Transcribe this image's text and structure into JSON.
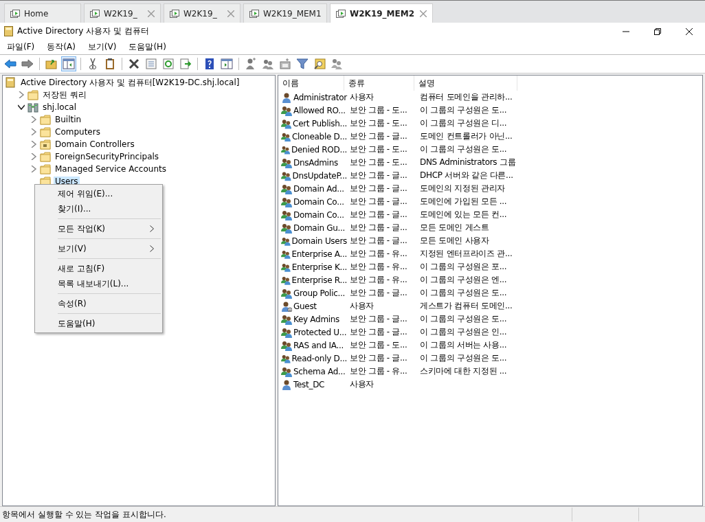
{
  "browser_tabs": [
    {
      "label": "Home",
      "selected": false,
      "closable": false
    },
    {
      "label": "W2K19_",
      "selected": false,
      "closable": true
    },
    {
      "label": "W2K19_",
      "selected": false,
      "closable": true
    },
    {
      "label": "W2K19_MEM1",
      "selected": false,
      "closable": false
    },
    {
      "label": "W2K19_MEM2",
      "selected": true,
      "closable": true
    }
  ],
  "window": {
    "title": "Active Directory 사용자 및 컴퓨터"
  },
  "menu": [
    "파일(F)",
    "동작(A)",
    "보기(V)",
    "도움말(H)"
  ],
  "tree": [
    {
      "label": "Active Directory 사용자 및 컴퓨터[W2K19-DC.shj.local]",
      "kind": "root",
      "selected": false,
      "children": [
        {
          "label": "저장된 쿼리",
          "kind": "folder",
          "expanded": false,
          "selected": false
        },
        {
          "label": "shj.local",
          "kind": "domain",
          "expanded": true,
          "selected": false,
          "children": [
            {
              "label": "Builtin",
              "kind": "folder",
              "expanded": false,
              "selected": false
            },
            {
              "label": "Computers",
              "kind": "folder",
              "expanded": false,
              "selected": false
            },
            {
              "label": "Domain Controllers",
              "kind": "ou",
              "expanded": false,
              "selected": false
            },
            {
              "label": "ForeignSecurityPrincipals",
              "kind": "folder",
              "expanded": false,
              "selected": false
            },
            {
              "label": "Managed Service Accounts",
              "kind": "folder",
              "expanded": false,
              "selected": false
            },
            {
              "label": "Users",
              "kind": "leaf",
              "selected": true
            }
          ]
        }
      ]
    }
  ],
  "context_menu": [
    {
      "kind": "item",
      "label": "제어 위임(E)...",
      "submenu": false
    },
    {
      "kind": "item",
      "label": "찾기(I)...",
      "submenu": false
    },
    {
      "kind": "separator"
    },
    {
      "kind": "item",
      "label": "모든 작업(K)",
      "submenu": true
    },
    {
      "kind": "separator"
    },
    {
      "kind": "item",
      "label": "보기(V)",
      "submenu": true
    },
    {
      "kind": "separator"
    },
    {
      "kind": "item",
      "label": "새로 고침(F)",
      "submenu": false
    },
    {
      "kind": "item",
      "label": "목록 내보내기(L)...",
      "submenu": false
    },
    {
      "kind": "separator"
    },
    {
      "kind": "item",
      "label": "속성(R)",
      "submenu": false
    },
    {
      "kind": "separator"
    },
    {
      "kind": "item",
      "label": "도움말(H)",
      "submenu": false
    }
  ],
  "list": {
    "columns": [
      "이름",
      "종류",
      "설명"
    ],
    "rows": [
      {
        "kind": "user",
        "name": "Administrator",
        "type": "사용자",
        "description": "컴퓨터 도메인을 관리하..."
      },
      {
        "kind": "group",
        "name": "Allowed RO...",
        "type": "보안 그룹 - 도...",
        "description": "이 그룹의 구성원은 도..."
      },
      {
        "kind": "group",
        "name": "Cert Publish...",
        "type": "보안 그룹 - 도...",
        "description": "이 그룹의 구성원은 디..."
      },
      {
        "kind": "group",
        "name": "Cloneable D...",
        "type": "보안 그룹 - 글...",
        "description": "도메인 컨트롤러가 아닌..."
      },
      {
        "kind": "group",
        "name": "Denied ROD...",
        "type": "보안 그룹 - 도...",
        "description": "이 그룹의 구성원은 도..."
      },
      {
        "kind": "group",
        "name": "DnsAdmins",
        "type": "보안 그룹 - 도...",
        "description": "DNS Administrators 그룹"
      },
      {
        "kind": "group",
        "name": "DnsUpdateP...",
        "type": "보안 그룹 - 글...",
        "description": "DHCP 서버와 같은 다른..."
      },
      {
        "kind": "group",
        "name": "Domain Ad...",
        "type": "보안 그룹 - 글...",
        "description": "도메인의 지정된 관리자"
      },
      {
        "kind": "group",
        "name": "Domain Co...",
        "type": "보안 그룹 - 글...",
        "description": "도메인에 가입된 모든 ..."
      },
      {
        "kind": "group",
        "name": "Domain Co...",
        "type": "보안 그룹 - 글...",
        "description": "도메인에 있는 모든 컨..."
      },
      {
        "kind": "group",
        "name": "Domain Gu...",
        "type": "보안 그룹 - 글...",
        "description": "모든 도메인 게스트"
      },
      {
        "kind": "group",
        "name": "Domain Users",
        "type": "보안 그룹 - 글...",
        "description": "모든 도메인 사용자"
      },
      {
        "kind": "group",
        "name": "Enterprise A...",
        "type": "보안 그룹 - 유...",
        "description": "지정된 엔터프라이즈 관..."
      },
      {
        "kind": "group",
        "name": "Enterprise K...",
        "type": "보안 그룹 - 유...",
        "description": "이 그룹의 구성원은 포..."
      },
      {
        "kind": "group",
        "name": "Enterprise R...",
        "type": "보안 그룹 - 유...",
        "description": "이 그룹의 구성원은 엔..."
      },
      {
        "kind": "group",
        "name": "Group Polic...",
        "type": "보안 그룹 - 글...",
        "description": "이 그룹의 구성원은 도..."
      },
      {
        "kind": "disabled-user",
        "name": "Guest",
        "type": "사용자",
        "description": "게스트가 컴퓨터 도메인..."
      },
      {
        "kind": "group",
        "name": "Key Admins",
        "type": "보안 그룹 - 글...",
        "description": "이 그룹의 구성원은 도..."
      },
      {
        "kind": "group",
        "name": "Protected U...",
        "type": "보안 그룹 - 글...",
        "description": "이 그룹의 구성원은 인..."
      },
      {
        "kind": "group",
        "name": "RAS and IA...",
        "type": "보안 그룹 - 도...",
        "description": "이 그룹의 서버는 사용..."
      },
      {
        "kind": "group",
        "name": "Read-only D...",
        "type": "보안 그룹 - 글...",
        "description": "이 그룹의 구성원은 도..."
      },
      {
        "kind": "group",
        "name": "Schema Ad...",
        "type": "보안 그룹 - 유...",
        "description": "스키마에 대한 지정된 ..."
      },
      {
        "kind": "user",
        "name": "Test_DC",
        "type": "사용자"
      }
    ]
  },
  "status_bar": {
    "text": "항목에서 실행할 수 있는 작업을 표시합니다."
  }
}
